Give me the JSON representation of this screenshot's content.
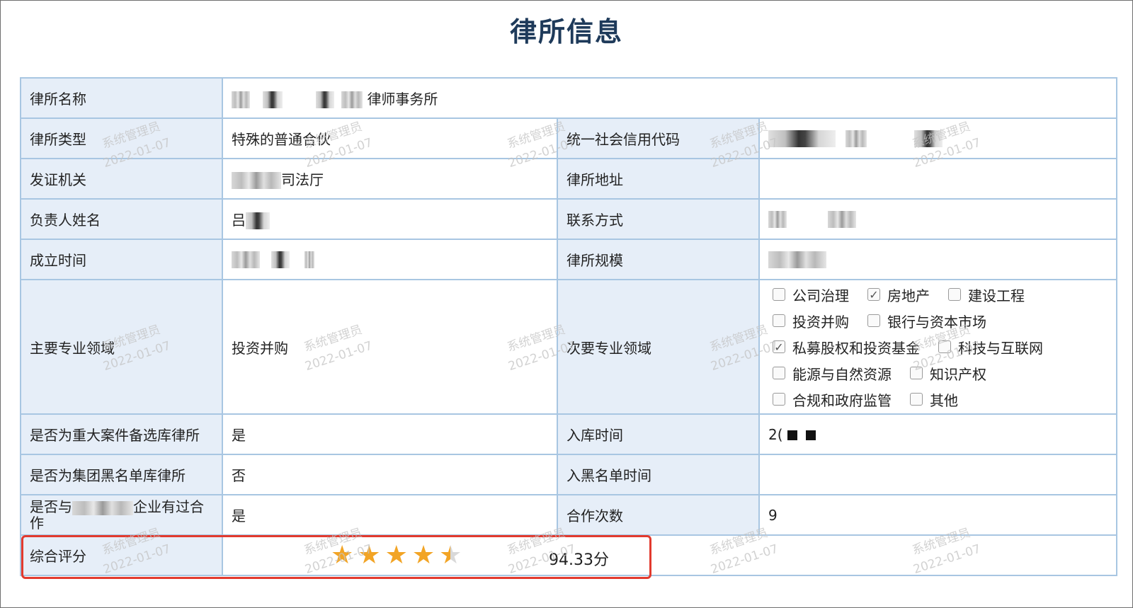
{
  "title": "律所信息",
  "rows": {
    "name": {
      "label": "律所名称",
      "value_suffix": "律师事务所"
    },
    "type": {
      "label": "律所类型",
      "value": "特殊的普通合伙"
    },
    "credit_code": {
      "label": "统一社会信用代码"
    },
    "issuer": {
      "label": "发证机关",
      "value_suffix": "司法厅"
    },
    "address": {
      "label": "律所地址",
      "value": ""
    },
    "principal": {
      "label": "负责人姓名",
      "value_prefix": "吕"
    },
    "contact": {
      "label": "联系方式"
    },
    "founded": {
      "label": "成立时间"
    },
    "scale": {
      "label": "律所规模"
    },
    "primary_field": {
      "label": "主要专业领域",
      "value": "投资并购"
    },
    "secondary_field": {
      "label": "次要专业领域"
    },
    "major_case": {
      "label": "是否为重大案件备选库律所",
      "value": "是"
    },
    "entry_time": {
      "label": "入库时间",
      "value_prefix": "2("
    },
    "blacklist": {
      "label": "是否为集团黑名单库律所",
      "value": "否"
    },
    "blacklist_time": {
      "label": "入黑名单时间",
      "value": ""
    },
    "cooperated": {
      "label_prefix": "是否与",
      "label_suffix": "企业有过合作",
      "value": "是"
    },
    "coop_count": {
      "label": "合作次数",
      "value": "9"
    },
    "rating": {
      "label": "综合评分",
      "stars": 4.5,
      "score": "94.33分"
    }
  },
  "secondary_options": [
    [
      {
        "label": "公司治理",
        "checked": false
      },
      {
        "label": "房地产",
        "checked": true
      },
      {
        "label": "建设工程",
        "checked": false
      }
    ],
    [
      {
        "label": "投资并购",
        "checked": false
      },
      {
        "label": "银行与资本市场",
        "checked": false
      }
    ],
    [
      {
        "label": "私募股权和投资基金",
        "checked": true
      },
      {
        "label": "科技与互联网",
        "checked": false
      }
    ],
    [
      {
        "label": "能源与自然资源",
        "checked": false
      },
      {
        "label": "知识产权",
        "checked": false
      }
    ],
    [
      {
        "label": "合规和政府监管",
        "checked": false
      },
      {
        "label": "其他",
        "checked": false
      }
    ]
  ],
  "watermark": {
    "line1": "系统管理员",
    "line2": "2022-01-07"
  },
  "colors": {
    "title": "#1e3a5a",
    "label_bg": "#e6eef8",
    "border": "#a8c6e2",
    "star": "#f2a425",
    "highlight": "#e23a2e"
  }
}
